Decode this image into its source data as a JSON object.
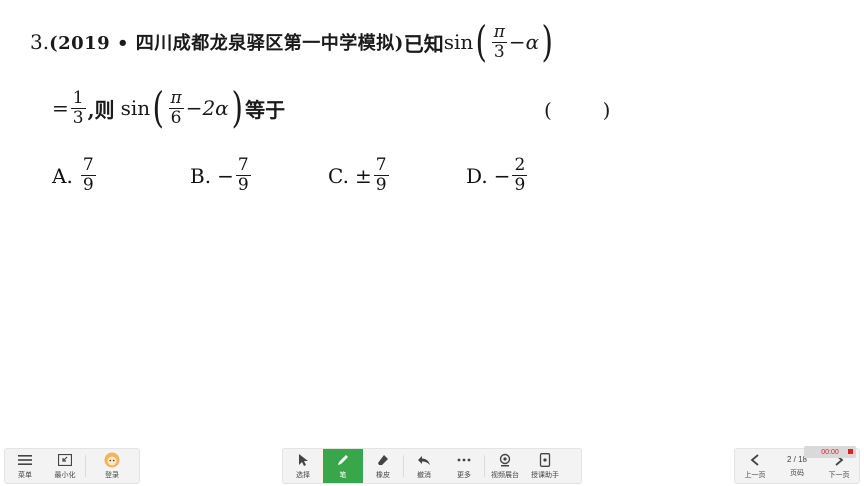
{
  "question": {
    "number": "3.",
    "source": "(2019 • 四川成都龙泉驿区第一中学模拟)",
    "known": "已知",
    "sin": "sin",
    "pi": "π",
    "three": "3",
    "minus": "−",
    "alpha": "α",
    "eq": "=",
    "one": "1",
    "then": ",则",
    "six": "6",
    "two_alpha": "2α",
    "equals_word": "等于",
    "blank": "(        )"
  },
  "options": [
    {
      "label": "A.",
      "sign": "",
      "num": "7",
      "den": "9"
    },
    {
      "label": "B.",
      "sign": "−",
      "num": "7",
      "den": "9"
    },
    {
      "label": "C.",
      "sign": "±",
      "num": "7",
      "den": "9"
    },
    {
      "label": "D.",
      "sign": "−",
      "num": "2",
      "den": "9"
    }
  ],
  "toolbar_left": {
    "menu": "菜单",
    "minimize": "最小化",
    "login": "登录"
  },
  "toolbar_center": {
    "select": "选择",
    "pen": "笔",
    "eraser": "橡皮",
    "undo": "撤消",
    "more": "更多",
    "camera": "视频展台",
    "assistant": "授课助手"
  },
  "pager": {
    "prev": "上一页",
    "page": "2 / 18",
    "page_label": "页码",
    "next": "下一页",
    "timer": "00:00"
  },
  "colors": {
    "pen_active": "#3aa64a",
    "record": "#e02020"
  }
}
